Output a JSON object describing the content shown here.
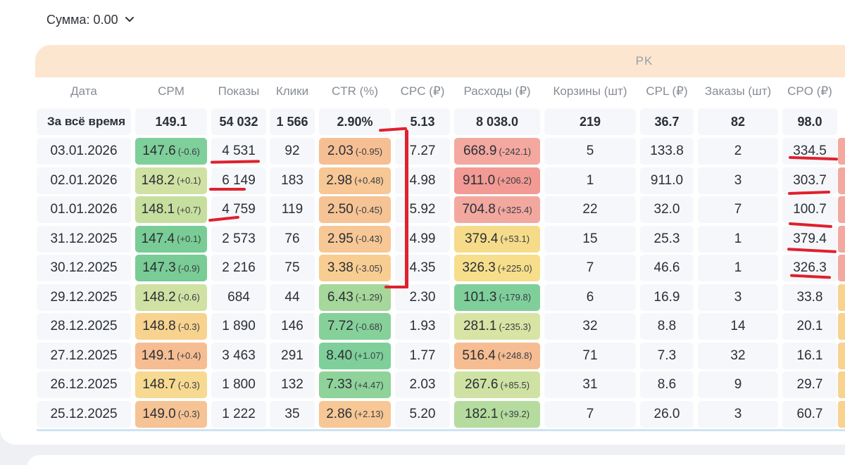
{
  "sum_select": {
    "label": "Сумма: 0.00"
  },
  "group_header": "PK",
  "columns": [
    "Дата",
    "CPM",
    "Показы",
    "Клики",
    "CTR (%)",
    "CPC (₽)",
    "Расходы (₽)",
    "Корзины (шт)",
    "CPL (₽)",
    "Заказы (шт)",
    "CPO (₽)"
  ],
  "totals": {
    "label": "За всё время",
    "cpm": "149.1",
    "shows": "54 032",
    "clicks": "1 566",
    "ctr": "2.90%",
    "cpc": "5.13",
    "spend": "8 038.0",
    "carts": "219",
    "cpl": "36.7",
    "orders": "82",
    "cpo": "98.0"
  },
  "rows": [
    {
      "date": "03.01.2026",
      "cpm": "147.6",
      "cpm_d": "(-0.6)",
      "cpm_c": "#7fcf9a",
      "shows": "4 531",
      "clicks": "92",
      "ctr": "2.03",
      "ctr_d": "(-0.95)",
      "ctr_c": "#f6bf93",
      "cpc": "7.27",
      "spend": "668.9",
      "spend_d": "(-242.1)",
      "spend_c": "#f3a8a0",
      "carts": "5",
      "cpl": "133.8",
      "orders": "2",
      "cpo": "334.5"
    },
    {
      "date": "02.01.2026",
      "cpm": "148.2",
      "cpm_d": "(+0.1)",
      "cpm_c": "#cfe2a3",
      "shows": "6 149",
      "clicks": "183",
      "ctr": "2.98",
      "ctr_d": "(+0.48)",
      "ctr_c": "#f7c795",
      "cpc": "4.98",
      "spend": "911.0",
      "spend_d": "(+206.2)",
      "spend_c": "#f29a93",
      "carts": "1",
      "cpl": "911.0",
      "orders": "3",
      "cpo": "303.7"
    },
    {
      "date": "01.01.2026",
      "cpm": "148.1",
      "cpm_d": "(+0.7)",
      "cpm_c": "#c6df9f",
      "shows": "4 759",
      "clicks": "119",
      "ctr": "2.50",
      "ctr_d": "(-0.45)",
      "ctr_c": "#f6c394",
      "cpc": "5.92",
      "spend": "704.8",
      "spend_d": "(+325.4)",
      "spend_c": "#f3a89f",
      "carts": "22",
      "cpl": "32.0",
      "orders": "7",
      "cpo": "100.7"
    },
    {
      "date": "31.12.2025",
      "cpm": "147.4",
      "cpm_d": "(+0.1)",
      "cpm_c": "#79cc95",
      "shows": "2 573",
      "clicks": "76",
      "ctr": "2.95",
      "ctr_d": "(-0.43)",
      "ctr_c": "#f7c795",
      "cpc": "4.99",
      "spend": "379.4",
      "spend_d": "(+53.1)",
      "spend_c": "#f6dc8a",
      "carts": "15",
      "cpl": "25.3",
      "orders": "1",
      "cpo": "379.4"
    },
    {
      "date": "30.12.2025",
      "cpm": "147.3",
      "cpm_d": "(-0.9)",
      "cpm_c": "#79cc95",
      "shows": "2 216",
      "clicks": "75",
      "ctr": "3.38",
      "ctr_d": "(-3.05)",
      "ctr_c": "#f8cd92",
      "cpc": "4.35",
      "spend": "326.3",
      "spend_d": "(+225.0)",
      "spend_c": "#f6de8b",
      "carts": "7",
      "cpl": "46.6",
      "orders": "1",
      "cpo": "326.3"
    },
    {
      "date": "29.12.2025",
      "cpm": "148.2",
      "cpm_d": "(-0.6)",
      "cpm_c": "#cfe2a3",
      "shows": "684",
      "clicks": "44",
      "ctr": "6.43",
      "ctr_d": "(-1.29)",
      "ctr_c": "#a6d79b",
      "cpc": "2.30",
      "spend": "101.3",
      "spend_d": "(-179.8)",
      "spend_c": "#7fcf9a",
      "carts": "6",
      "cpl": "16.9",
      "orders": "3",
      "cpo": "33.8"
    },
    {
      "date": "28.12.2025",
      "cpm": "148.8",
      "cpm_d": "(-0.3)",
      "cpm_c": "#f7d38f",
      "shows": "1 890",
      "clicks": "146",
      "ctr": "7.72",
      "ctr_d": "(-0.68)",
      "ctr_c": "#86d199",
      "cpc": "1.93",
      "spend": "281.1",
      "spend_d": "(-235.3)",
      "spend_c": "#d8e4a4",
      "carts": "32",
      "cpl": "8.8",
      "orders": "14",
      "cpo": "20.1"
    },
    {
      "date": "27.12.2025",
      "cpm": "149.1",
      "cpm_d": "(+0.4)",
      "cpm_c": "#f6bd92",
      "shows": "3 463",
      "clicks": "291",
      "ctr": "8.40",
      "ctr_d": "(+1.07)",
      "ctr_c": "#7fcf9a",
      "cpc": "1.77",
      "spend": "516.4",
      "spend_d": "(+248.8)",
      "spend_c": "#f6bd92",
      "carts": "71",
      "cpl": "7.3",
      "orders": "32",
      "cpo": "16.1"
    },
    {
      "date": "26.12.2025",
      "cpm": "148.7",
      "cpm_d": "(-0.3)",
      "cpm_c": "#f7d991",
      "shows": "1 800",
      "clicks": "132",
      "ctr": "7.33",
      "ctr_d": "(+4.47)",
      "ctr_c": "#8fd39a",
      "cpc": "2.03",
      "spend": "267.6",
      "spend_d": "(+85.5)",
      "spend_c": "#cfe2a3",
      "carts": "31",
      "cpl": "8.6",
      "orders": "9",
      "cpo": "29.7"
    },
    {
      "date": "25.12.2025",
      "cpm": "149.0",
      "cpm_d": "(-0.3)",
      "cpm_c": "#f6c394",
      "shows": "1 222",
      "clicks": "35",
      "ctr": "2.86",
      "ctr_d": "(+2.13)",
      "ctr_c": "#f7c795",
      "cpc": "5.20",
      "spend": "182.1",
      "spend_d": "(+39.2)",
      "spend_c": "#b5dc9e",
      "carts": "7",
      "cpl": "26.0",
      "orders": "3",
      "cpo": "60.7"
    }
  ],
  "colors": {
    "annotation_red": "#e0202e",
    "header_peach": "#fce6cf",
    "cell_plain": "#f5f7fa"
  }
}
